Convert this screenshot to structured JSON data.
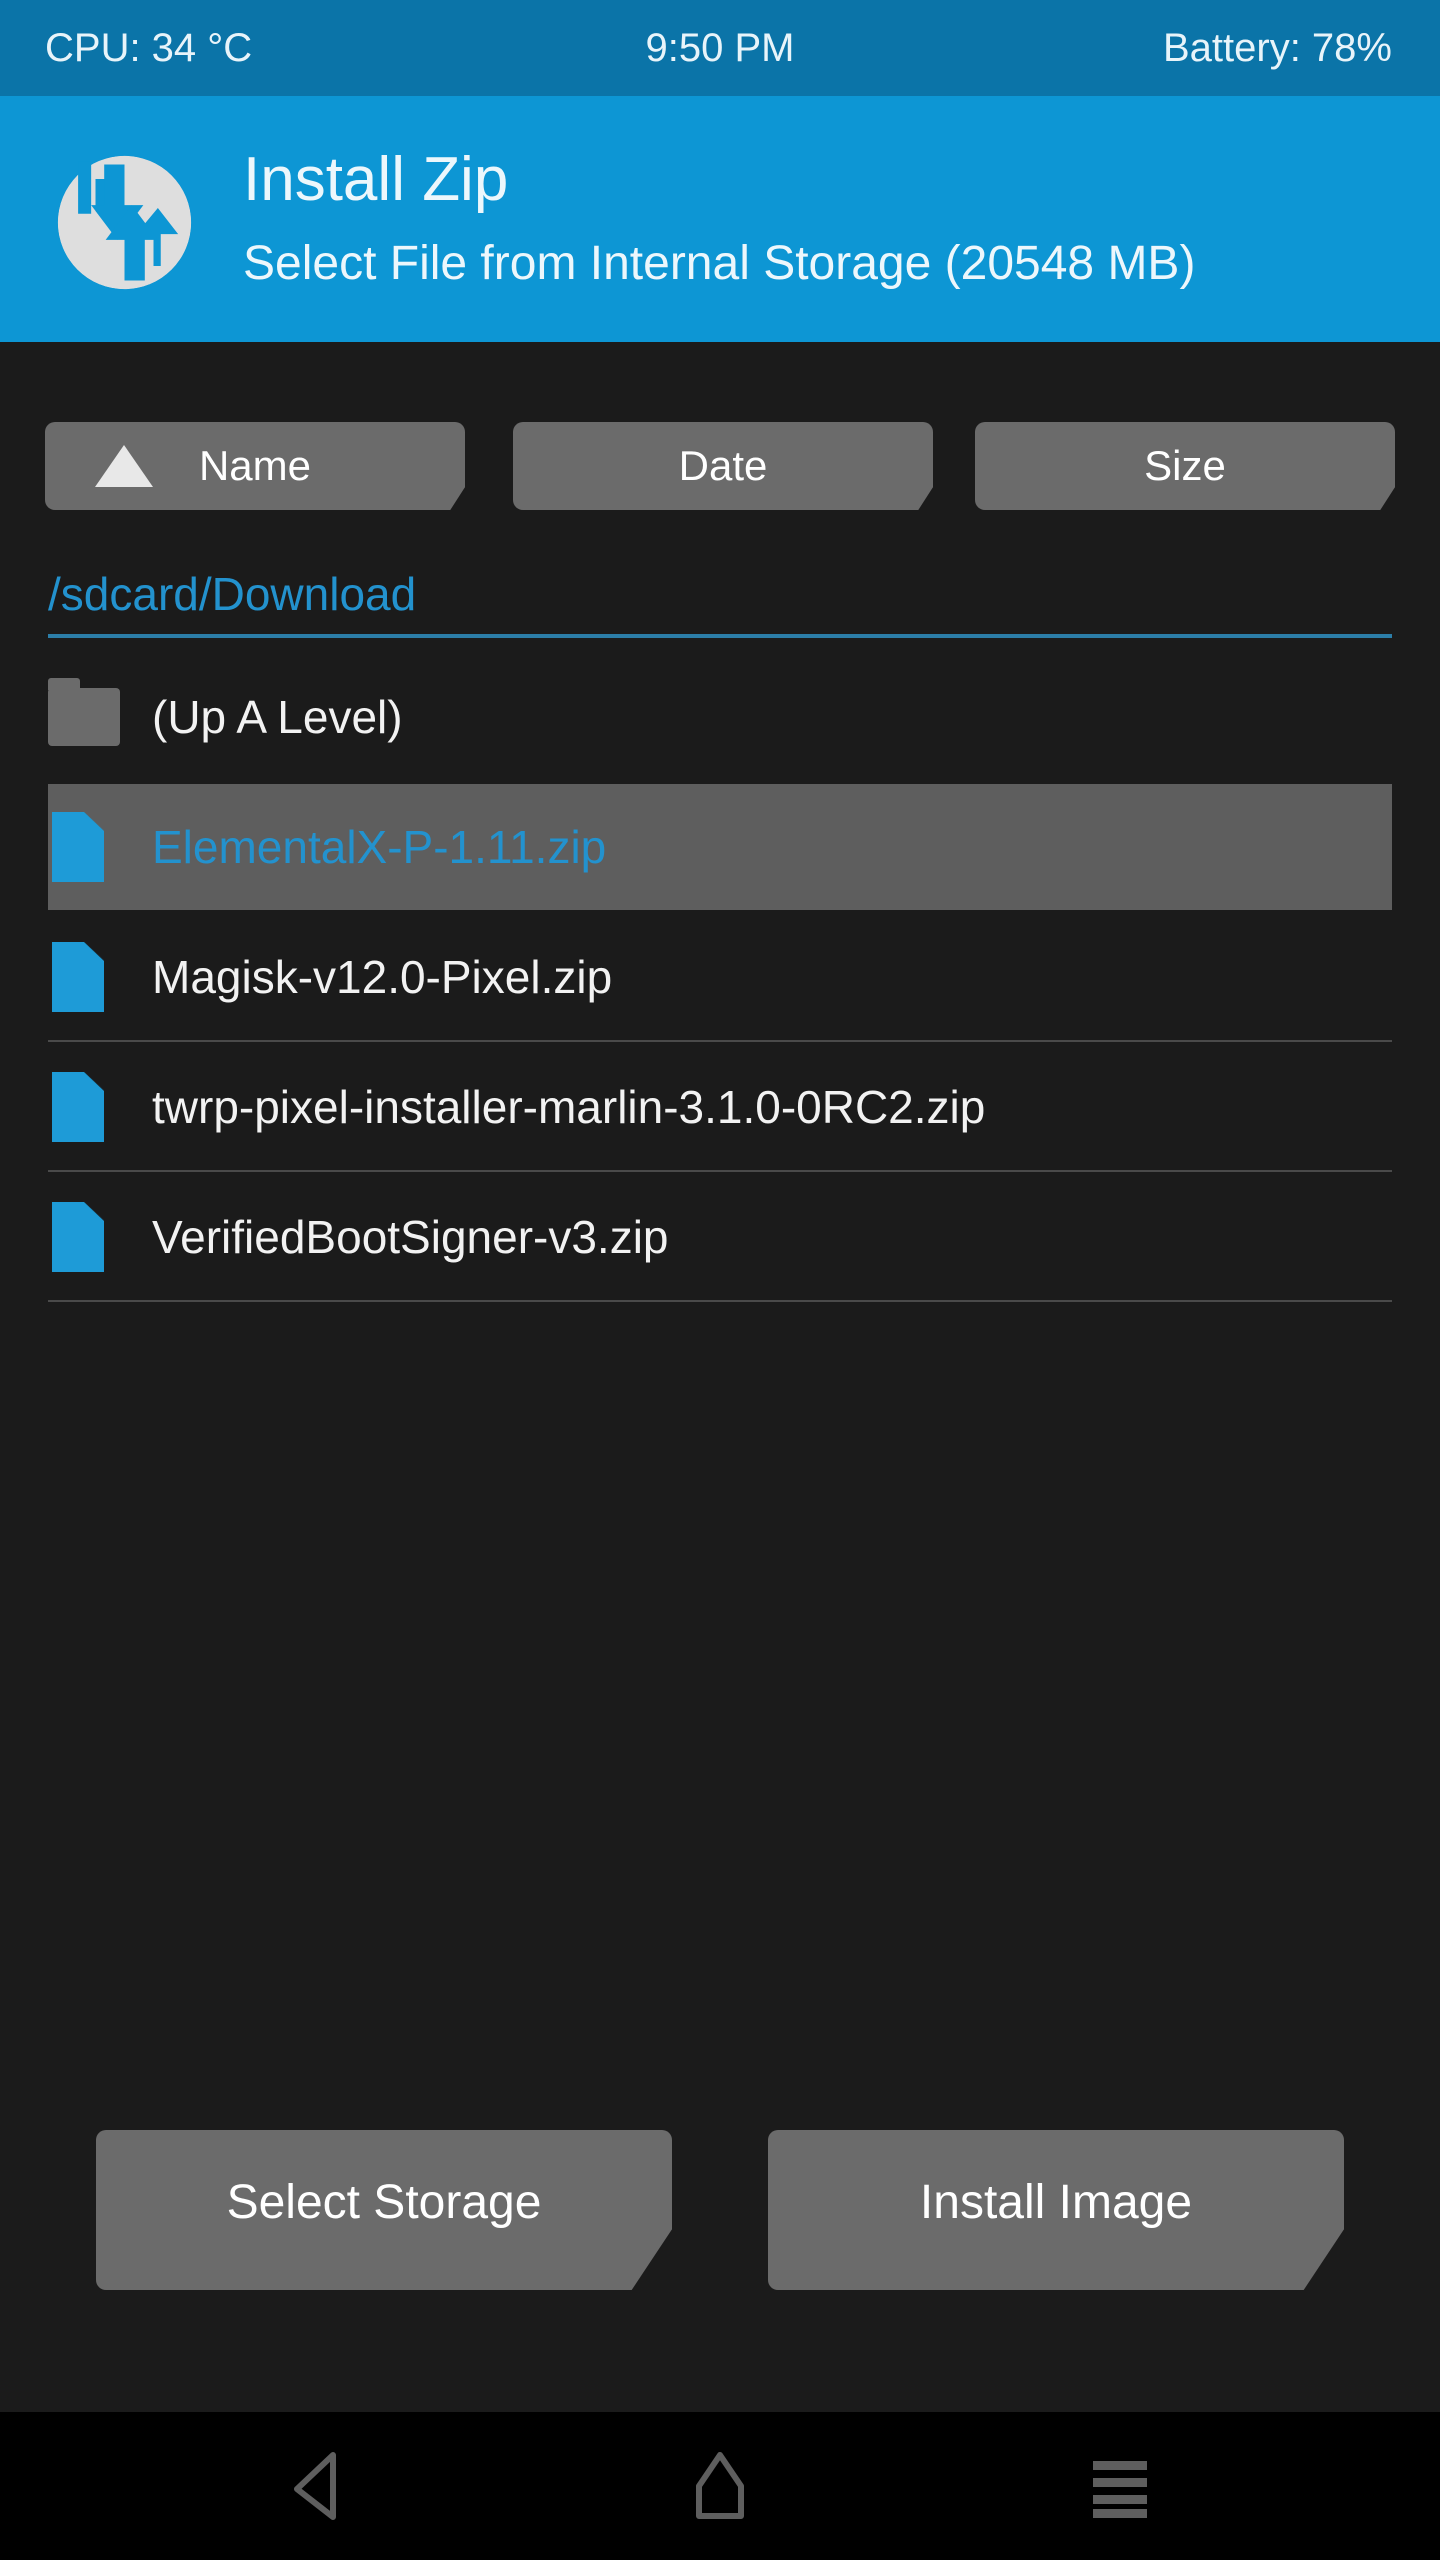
{
  "status_bar": {
    "cpu": "CPU: 34 °C",
    "clock": "9:50 PM",
    "battery": "Battery: 78%",
    "background_color": "#0b74a8",
    "text_color": "#e8f4fa"
  },
  "header": {
    "logo_icon": "twrp-logo-icon",
    "title": "Install Zip",
    "subtitle": "Select File from Internal Storage (20548 MB)",
    "background_color": "#0d96d4",
    "text_color": "#ecf7fc"
  },
  "sort_bar": {
    "sort_direction_icon": "sort-ascending-triangle-icon",
    "buttons": [
      {
        "label": "Name",
        "active": true,
        "has_arrow": true
      },
      {
        "label": "Date",
        "active": false,
        "has_arrow": false
      },
      {
        "label": "Size",
        "active": false,
        "has_arrow": false
      }
    ],
    "button_color": "#6b6b6b"
  },
  "path": {
    "current_path": "/sdcard/Download",
    "text_color": "#2392ce",
    "divider_color": "#2c7ea8"
  },
  "file_list": {
    "selected_color": "#5e5e5e",
    "accent_color": "#1e9bd7",
    "items": [
      {
        "label": "(Up A Level)",
        "icon": "folder-icon",
        "type": "folder",
        "selected": false,
        "divider": false
      },
      {
        "label": "ElementalX-P-1.11.zip",
        "icon": "file-icon",
        "type": "file",
        "selected": true,
        "divider": false
      },
      {
        "label": "Magisk-v12.0-Pixel.zip",
        "icon": "file-icon",
        "type": "file",
        "selected": false,
        "divider": true
      },
      {
        "label": "twrp-pixel-installer-marlin-3.1.0-0RC2.zip",
        "icon": "file-icon",
        "type": "file",
        "selected": false,
        "divider": true
      },
      {
        "label": "VerifiedBootSigner-v3.zip",
        "icon": "file-icon",
        "type": "file",
        "selected": false,
        "divider": true
      }
    ]
  },
  "action_bar": {
    "select_storage_label": "Select Storage",
    "install_image_label": "Install Image",
    "button_color": "#6b6b6b"
  },
  "nav_bar": {
    "back_icon": "back-triangle-icon",
    "home_icon": "home-icon",
    "menu_icon": "menu-lines-icon",
    "icon_color": "#5e5e5e",
    "background_color": "#000000"
  }
}
